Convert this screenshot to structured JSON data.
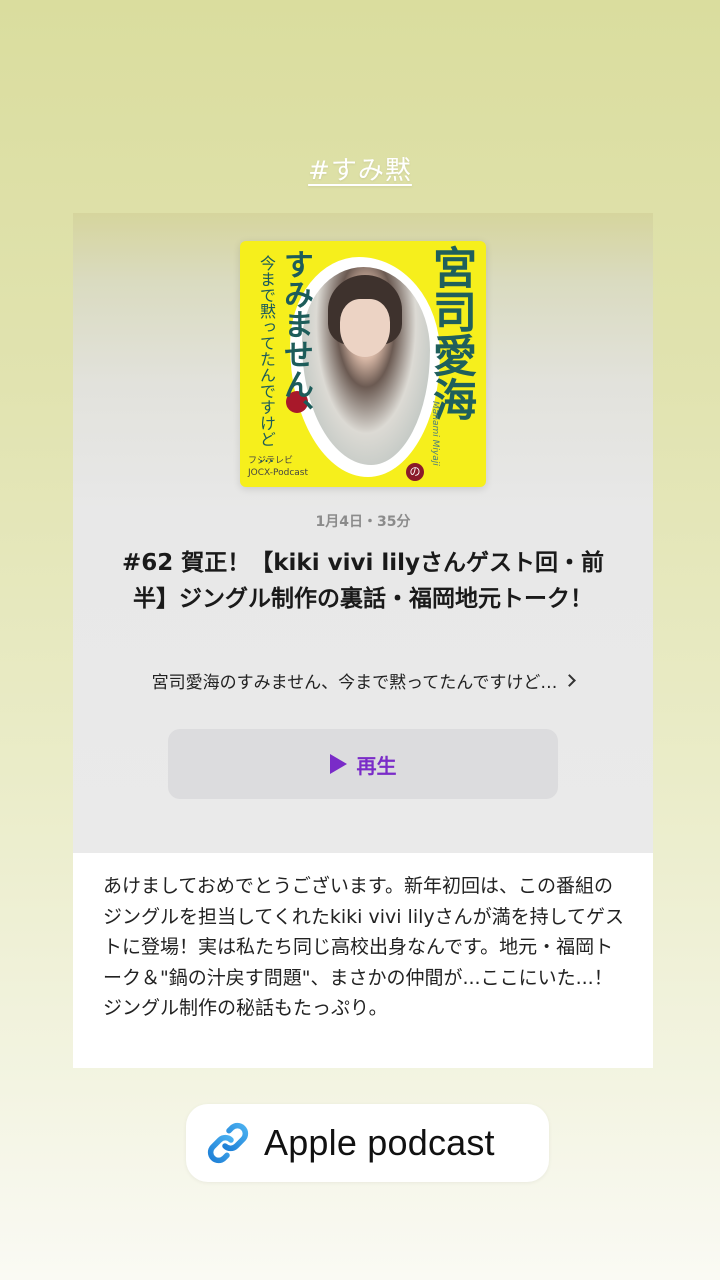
{
  "hashtag": "#すみ黙",
  "episode": {
    "artwork": {
      "vertical_title": "宮司愛海",
      "vertical_no": "の",
      "vertical_main": "すみません、",
      "vertical_sub": "今まで黙ってたんですけど…",
      "name_en": "Manami Miyaji",
      "brand_line1": "フジテレビ",
      "brand_line2": "JOCX-Podcast"
    },
    "meta": "1月4日・35分",
    "title": "#62 賀正！【kiki vivi lilyさんゲスト回・前半】ジングル制作の裏話・福岡地元トーク！",
    "show_name": "宮司愛海のすみません、今まで黙ってたんですけど…",
    "play_label": "再生",
    "description": "あけましておめでとうございます。新年初回は、この番組のジングルを担当してくれたkiki vivi lilyさんが満を持してゲストに登場！実は私たち同じ高校出身なんです。地元・福岡トーク＆\"鍋の汁戻す問題\"、まさかの仲間が...ここにいた...！ジングル制作の秘話もたっぷり。"
  },
  "link_sticker": {
    "icon": "link-icon",
    "label": "Apple podcast",
    "accent": "#2d8fe0"
  },
  "colors": {
    "play_accent": "#7a2bc8",
    "artwork_yellow": "#f6ef1c"
  }
}
